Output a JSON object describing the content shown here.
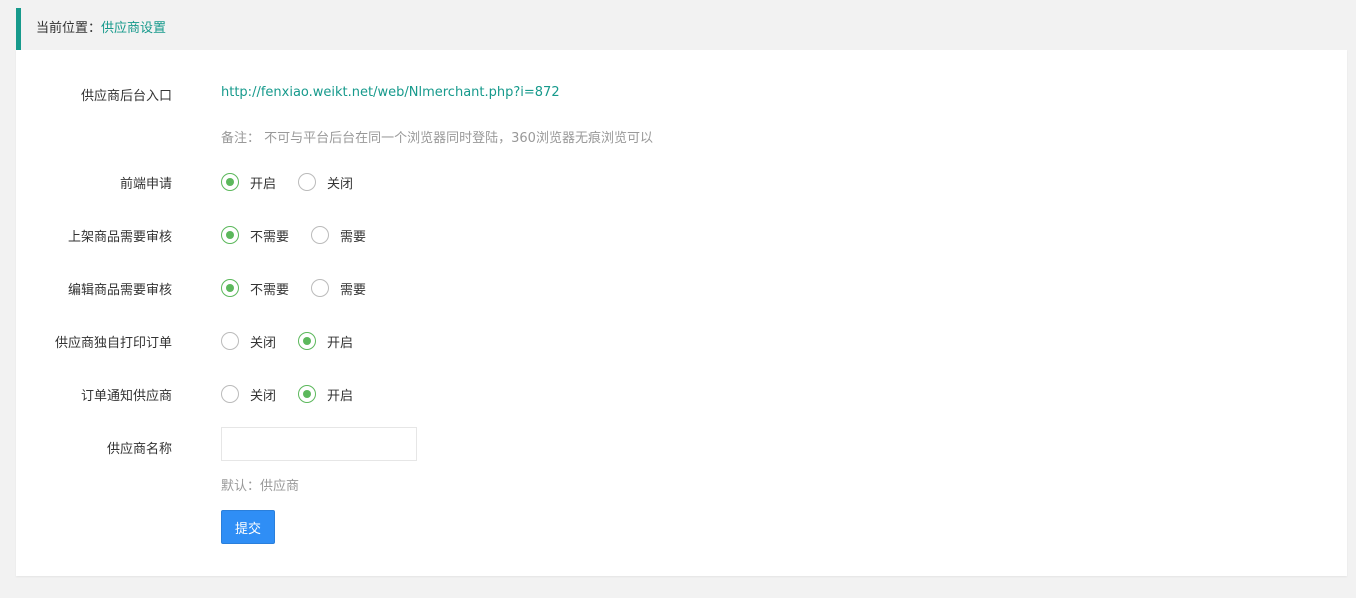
{
  "breadcrumb": {
    "prefix": "当前位置：",
    "current": "供应商设置"
  },
  "colors": {
    "accent": "#179a8c",
    "radio_checked": "#5cb85c",
    "button": "#2f8ef5"
  },
  "form": {
    "entry": {
      "label": "供应商后台入口",
      "url": "http://fenxiao.weikt.net/web/Nlmerchant.php?i=872",
      "note": "备注： 不可与平台后台在同一个浏览器同时登陆，360浏览器无痕浏览可以"
    },
    "frontend_apply": {
      "label": "前端申请",
      "options": [
        "开启",
        "关闭"
      ],
      "selected": "开启"
    },
    "listing_review": {
      "label": "上架商品需要审核",
      "options": [
        "不需要",
        "需要"
      ],
      "selected": "不需要"
    },
    "edit_review": {
      "label": "编辑商品需要审核",
      "options": [
        "不需要",
        "需要"
      ],
      "selected": "不需要"
    },
    "print_order": {
      "label": "供应商独自打印订单",
      "options": [
        "关闭",
        "开启"
      ],
      "selected": "开启"
    },
    "order_notify": {
      "label": "订单通知供应商",
      "options": [
        "关闭",
        "开启"
      ],
      "selected": "开启"
    },
    "supplier_name": {
      "label": "供应商名称",
      "value": "",
      "hint": "默认：供应商"
    },
    "submit_label": "提交"
  }
}
